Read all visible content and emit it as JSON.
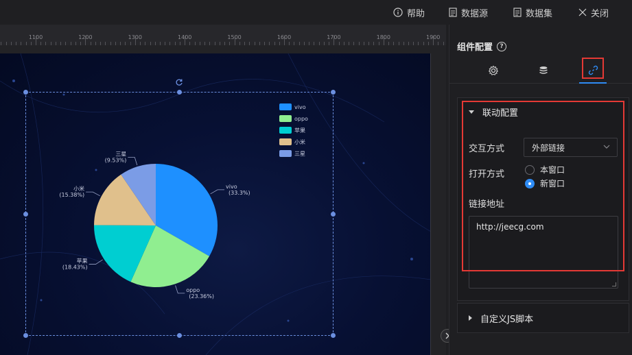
{
  "toolbar": {
    "help_label": "帮助",
    "datasource_label": "数据源",
    "dataset_label": "数据集",
    "close_label": "关闭"
  },
  "ruler": {
    "labels": [
      "1100",
      "1200",
      "1300",
      "1400",
      "1500",
      "1600",
      "1700",
      "1800",
      "1900"
    ]
  },
  "panel": {
    "title": "组件配置",
    "tabs": [
      {
        "icon": "gear-icon",
        "active": false
      },
      {
        "icon": "database-icon",
        "active": false
      },
      {
        "icon": "link-icon",
        "active": true
      }
    ],
    "linkage_section": {
      "title": "联动配置",
      "interaction_label": "交互方式",
      "interaction_value": "外部链接",
      "open_mode_label": "打开方式",
      "open_options": [
        {
          "label": "本窗口",
          "checked": false
        },
        {
          "label": "新窗口",
          "checked": true
        }
      ],
      "url_label": "链接地址",
      "url_value": "http://jeecg.com"
    },
    "js_section": {
      "title": "自定义JS脚本"
    }
  },
  "colors": {
    "accent": "#2f8cf5",
    "highlight": "#e53935"
  },
  "chart_data": {
    "type": "pie",
    "categories": [
      "vivo",
      "oppo",
      "苹果",
      "小米",
      "三星"
    ],
    "values": [
      33.3,
      23.36,
      18.43,
      15.38,
      9.53
    ],
    "labels": [
      "vivo\n(33.3%)",
      "oppo\n(23.36%)",
      "苹果\n(18.43%)",
      "小米\n(15.38%)",
      "三星\n(9.53%)"
    ],
    "colors": [
      "#1e90ff",
      "#90ee90",
      "#00ced1",
      "#e0c08c",
      "#7b9ce6"
    ],
    "legend": [
      "vivo",
      "oppo",
      "苹果",
      "小米",
      "三星"
    ],
    "legend_position": "top-right"
  }
}
